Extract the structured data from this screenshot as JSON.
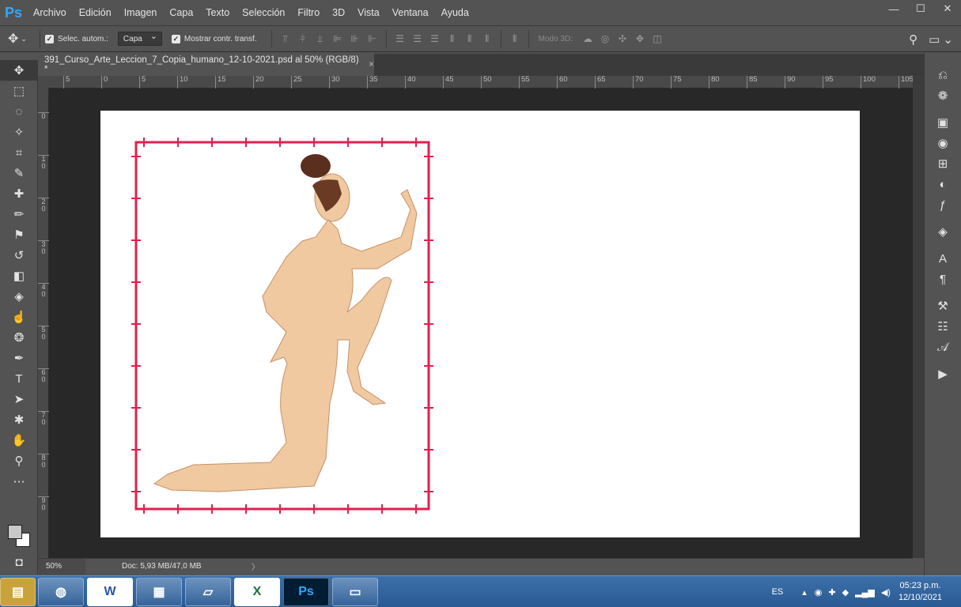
{
  "app": {
    "logo": "Ps",
    "menu": [
      "Archivo",
      "Edición",
      "Imagen",
      "Capa",
      "Texto",
      "Selección",
      "Filtro",
      "3D",
      "Vista",
      "Ventana",
      "Ayuda"
    ],
    "window_controls": [
      "—",
      "☐",
      "✕"
    ]
  },
  "options": {
    "auto_select_label": "Selec. autom.:",
    "auto_select_value": "Capa",
    "show_transform_label": "Mostrar contr. transf.",
    "mode3d_label": "Modo 3D:"
  },
  "document": {
    "tab_title": "391_Curso_Arte_Leccion_7_Copia_humano_12-10-2021.psd al 50% (RGB/8) *",
    "close_glyph": "×"
  },
  "ruler": {
    "h_labels": [
      "5",
      "0",
      "5",
      "10",
      "15",
      "20",
      "25",
      "30",
      "35",
      "40",
      "45",
      "50",
      "55",
      "60",
      "65",
      "70",
      "75",
      "80",
      "85",
      "90",
      "95",
      "100",
      "105"
    ],
    "v_labels": [
      "0",
      "1\n0",
      "2\n0",
      "3\n0",
      "4\n0",
      "5\n0",
      "6\n0",
      "7\n0",
      "8\n0",
      "9\n0"
    ]
  },
  "status": {
    "zoom": "50%",
    "doc_info": "Doc: 5,93 MB/47,0 MB",
    "chevron": "〉"
  },
  "taskbar": {
    "apps": [
      "chrome",
      "W",
      "calc",
      "notes",
      "X",
      "Ps",
      "img"
    ],
    "lang": "ES",
    "time": "05:23 p.m.",
    "date": "12/10/2021"
  },
  "colors": {
    "accent": "#31a8ff",
    "frame": "#e0204e",
    "skin": "#f0c9a0"
  }
}
